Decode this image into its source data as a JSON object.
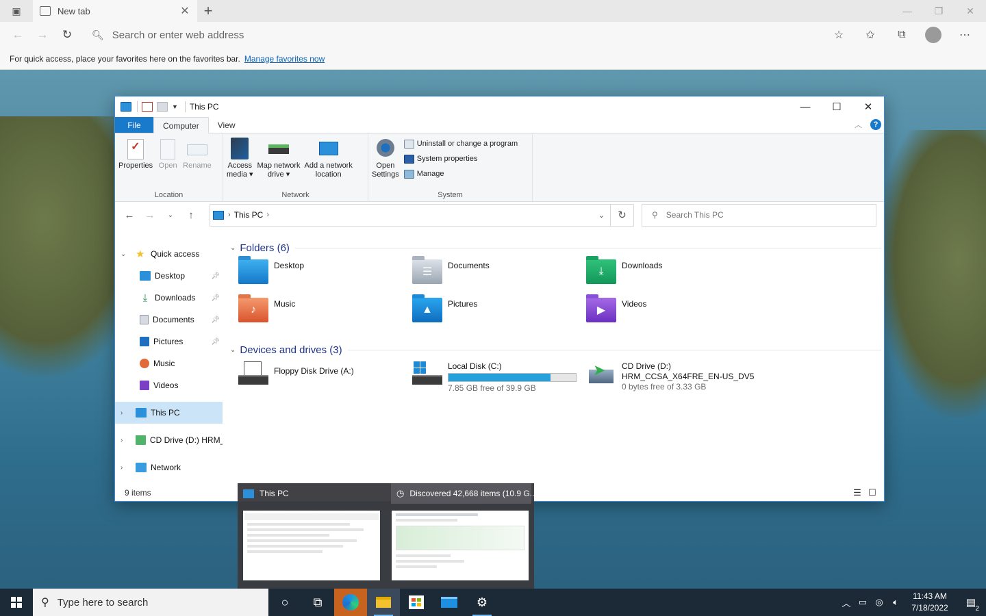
{
  "browser": {
    "tab_title": "New tab",
    "address_placeholder": "Search or enter web address",
    "favbar_text": "For quick access, place your favorites here on the favorites bar.",
    "favbar_link": "Manage favorites now"
  },
  "explorer": {
    "title": "This PC",
    "ribbon_tabs": {
      "file": "File",
      "computer": "Computer",
      "view": "View"
    },
    "location_group": {
      "label": "Location",
      "properties": "Properties",
      "open": "Open",
      "rename": "Rename"
    },
    "network_group": {
      "label": "Network",
      "access_media_1": "Access",
      "access_media_2": "media ▾",
      "map_drive_1": "Map network",
      "map_drive_2": "drive ▾",
      "add_location_1": "Add a network",
      "add_location_2": "location"
    },
    "system_group": {
      "label": "System",
      "open_settings_1": "Open",
      "open_settings_2": "Settings",
      "uninstall": "Uninstall or change a program",
      "system_properties": "System properties",
      "manage": "Manage"
    },
    "address": {
      "crumb": "This PC"
    },
    "search_placeholder": "Search This PC",
    "nav": {
      "quick_access": "Quick access",
      "desktop": "Desktop",
      "downloads": "Downloads",
      "documents": "Documents",
      "pictures": "Pictures",
      "music": "Music",
      "videos": "Videos",
      "this_pc": "This PC",
      "cd_drive": "CD Drive (D:) HRM_C",
      "network": "Network"
    },
    "folders_header": "Folders (6)",
    "folders": [
      "Desktop",
      "Documents",
      "Downloads",
      "Music",
      "Pictures",
      "Videos"
    ],
    "devices_header": "Devices and drives (3)",
    "drives": {
      "floppy": "Floppy Disk Drive (A:)",
      "local_name": "Local Disk (C:)",
      "local_free": "7.85 GB free of 39.9 GB",
      "local_used_fraction": 0.803,
      "cd_name": "CD Drive (D:)",
      "cd_label": "HRM_CCSA_X64FRE_EN-US_DV5",
      "cd_free": "0 bytes free of 3.33 GB"
    },
    "status_items": "9 items"
  },
  "preview": {
    "window1_title": "This PC",
    "window2_title": "Discovered 42,668 items (10.9 G..."
  },
  "taskbar": {
    "search_placeholder": "Type here to search",
    "time": "11:43 AM",
    "date": "7/18/2022",
    "notification_count": "2"
  }
}
